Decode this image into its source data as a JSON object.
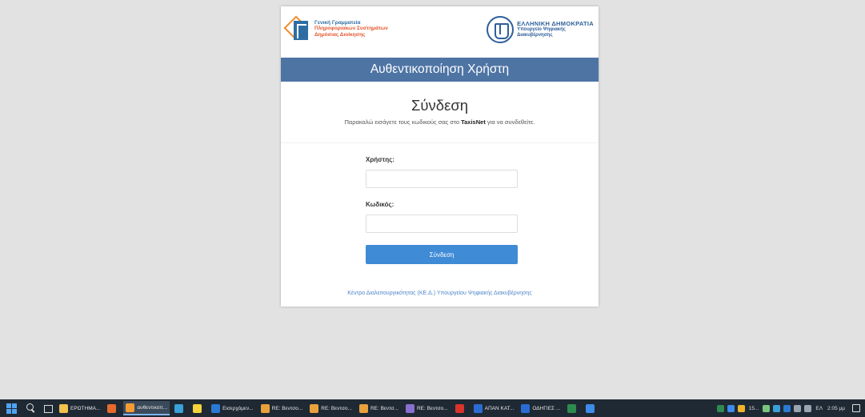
{
  "header": {
    "left_logo": {
      "line1": "Γενική Γραμματεία",
      "line2": "Πληροφοριακών Συστημάτων",
      "line3": "Δημόσιας Διοίκησης"
    },
    "right_logo": {
      "line1": "ΕΛΛΗΝΙΚΗ ΔΗΜΟΚΡΑΤΙΑ",
      "line2": "Υπουργείο Ψηφιακής",
      "line3": "Διακυβέρνησης"
    }
  },
  "title_bar": "Αυθεντικοποίηση Χρήστη",
  "login": {
    "heading": "Σύνδεση",
    "instructions_pre": "Παρακαλώ εισάγετε τους κωδικούς σας στο ",
    "instructions_bold": "TaxisNet",
    "instructions_post": " για να συνδεθείτε.",
    "username_label": "Χρήστης:",
    "username_value": "",
    "password_label": "Κωδικός:",
    "password_value": "",
    "submit_label": "Σύνδεση"
  },
  "footer": "Κέντρο Διαλειτουργικότητας (ΚΕ.Δ.) Υπουργείου Ψηφιακής Διακυβέρνησης",
  "taskbar": {
    "apps": [
      {
        "label": "ΕΡΩΤΗΜΑ...",
        "icon": "folder-icon",
        "color": "#f2c14e",
        "active": false
      },
      {
        "label": "",
        "icon": "firefox-icon",
        "color": "#e66a2c",
        "active": false
      },
      {
        "label": "αυθεντικοπ...",
        "icon": "browser-icon",
        "color": "#f39c34",
        "active": true
      },
      {
        "label": "",
        "icon": "edge-icon",
        "color": "#3aa0d8",
        "active": false
      },
      {
        "label": "",
        "icon": "pen-icon",
        "color": "#f5d33c",
        "active": false
      },
      {
        "label": "Εισερχόμεν...",
        "icon": "outlook-icon",
        "color": "#2a7ad3",
        "active": false
      },
      {
        "label": "RE: Βεντσο...",
        "icon": "mail-icon",
        "color": "#e9a13b",
        "active": false
      },
      {
        "label": "RE: Βεντσο...",
        "icon": "mail-icon",
        "color": "#e9a13b",
        "active": false
      },
      {
        "label": "RE: Βεντσ...",
        "icon": "mail-icon",
        "color": "#e9a13b",
        "active": false
      },
      {
        "label": "RE: Βεντσο...",
        "icon": "mail-icon",
        "color": "#8a6fd1",
        "active": false
      },
      {
        "label": "",
        "icon": "acrobat-icon",
        "color": "#d9342b",
        "active": false
      },
      {
        "label": "ΑΠΑΝ ΚΑΤ...",
        "icon": "word-icon",
        "color": "#2b6cd4",
        "active": false
      },
      {
        "label": "ΟΔΗΓΙΕΣ ...",
        "icon": "word-icon",
        "color": "#2b6cd4",
        "active": false
      },
      {
        "label": "",
        "icon": "excel-icon",
        "color": "#2e8b4f",
        "active": false
      },
      {
        "label": "",
        "icon": "chrome-icon",
        "color": "#3d8bea",
        "active": false
      }
    ],
    "tray": {
      "weather": "15...",
      "lang": "ΕΛ",
      "time": "2:05 μμ"
    }
  }
}
